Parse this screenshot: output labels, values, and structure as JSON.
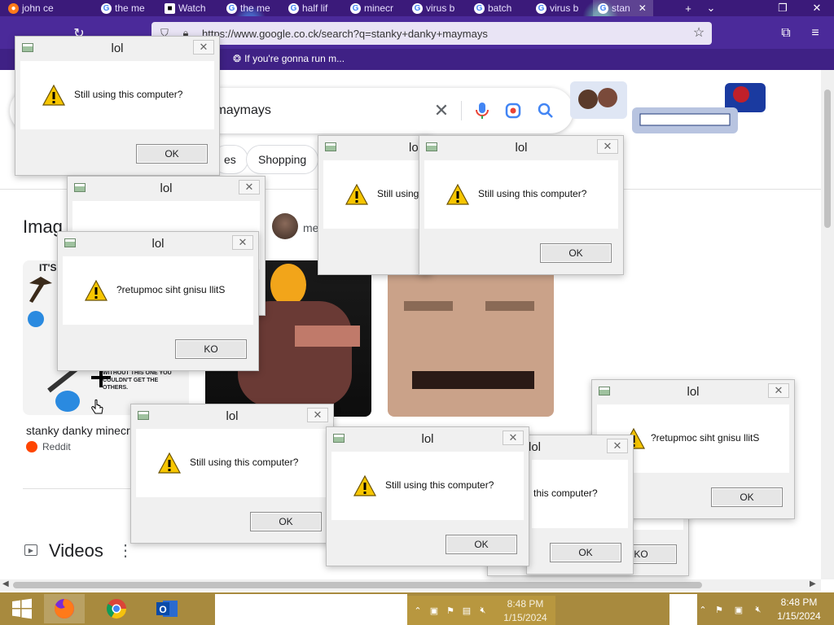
{
  "browser": {
    "tabs": [
      {
        "label": "john ce",
        "favicon": "firefox-icon"
      },
      {
        "label": "the me",
        "favicon": "google-icon"
      },
      {
        "label": "Watch",
        "favicon": "video-icon"
      },
      {
        "label": "the me",
        "favicon": "google-icon"
      },
      {
        "label": "half lif",
        "favicon": "google-icon"
      },
      {
        "label": "minecr",
        "favicon": "google-icon"
      },
      {
        "label": "virus b",
        "favicon": "google-icon"
      },
      {
        "label": "batch",
        "favicon": "google-icon"
      },
      {
        "label": "virus b",
        "favicon": "google-icon"
      },
      {
        "label": "stan",
        "favicon": "google-icon",
        "active": true
      }
    ],
    "url": "https://www.google.co.ck/search?q=stanky+danky+maymays",
    "bookmark": "If you're gonna run m..."
  },
  "google": {
    "query": "y maymays",
    "chips": [
      "es",
      "Shopping"
    ],
    "images_heading": "Imag",
    "me_label": "me",
    "result_title": "stanky danky minecr",
    "result_source": "Reddit",
    "videos_heading": "Videos",
    "meme_text_top": "IT'S",
    "meme_text_bottom": "WITHOUT THIS ONE YOU COULDN'T GET THE OTHERS."
  },
  "dialogs": [
    {
      "title": "lol",
      "message": "Still using this computer?",
      "button": "OK"
    },
    {
      "title": "lol",
      "message": "",
      "button": ""
    },
    {
      "title": "lol",
      "message": "?retupmoc siht gnisu llitS",
      "button": "KO"
    },
    {
      "title": "lol",
      "message": "Still using",
      "button": ""
    },
    {
      "title": "lol",
      "message": "Still using this computer?",
      "button": "OK"
    },
    {
      "title": "lol",
      "message": "?retupmoc siht gnisu llitS",
      "button": "OK"
    },
    {
      "title": "lol",
      "message": "Still using this computer?",
      "button": "OK"
    },
    {
      "title": "lol",
      "message": "this computer?",
      "button": "OK"
    },
    {
      "title": "lol",
      "message": "Still using this computer?",
      "button": "OK"
    },
    {
      "title": "",
      "message": "",
      "button": "KO"
    }
  ],
  "taskbar": {
    "time": "8:48 PM",
    "date": "1/15/2024",
    "ghost_time": "8:48 PM",
    "ghost_date": "1/15/2024"
  },
  "colors": {
    "tab_bar": "#3b1a7a",
    "taskbar": "#a88a3e",
    "dialog_face": "#f0f0f0",
    "warning_yellow": "#f7c600"
  }
}
